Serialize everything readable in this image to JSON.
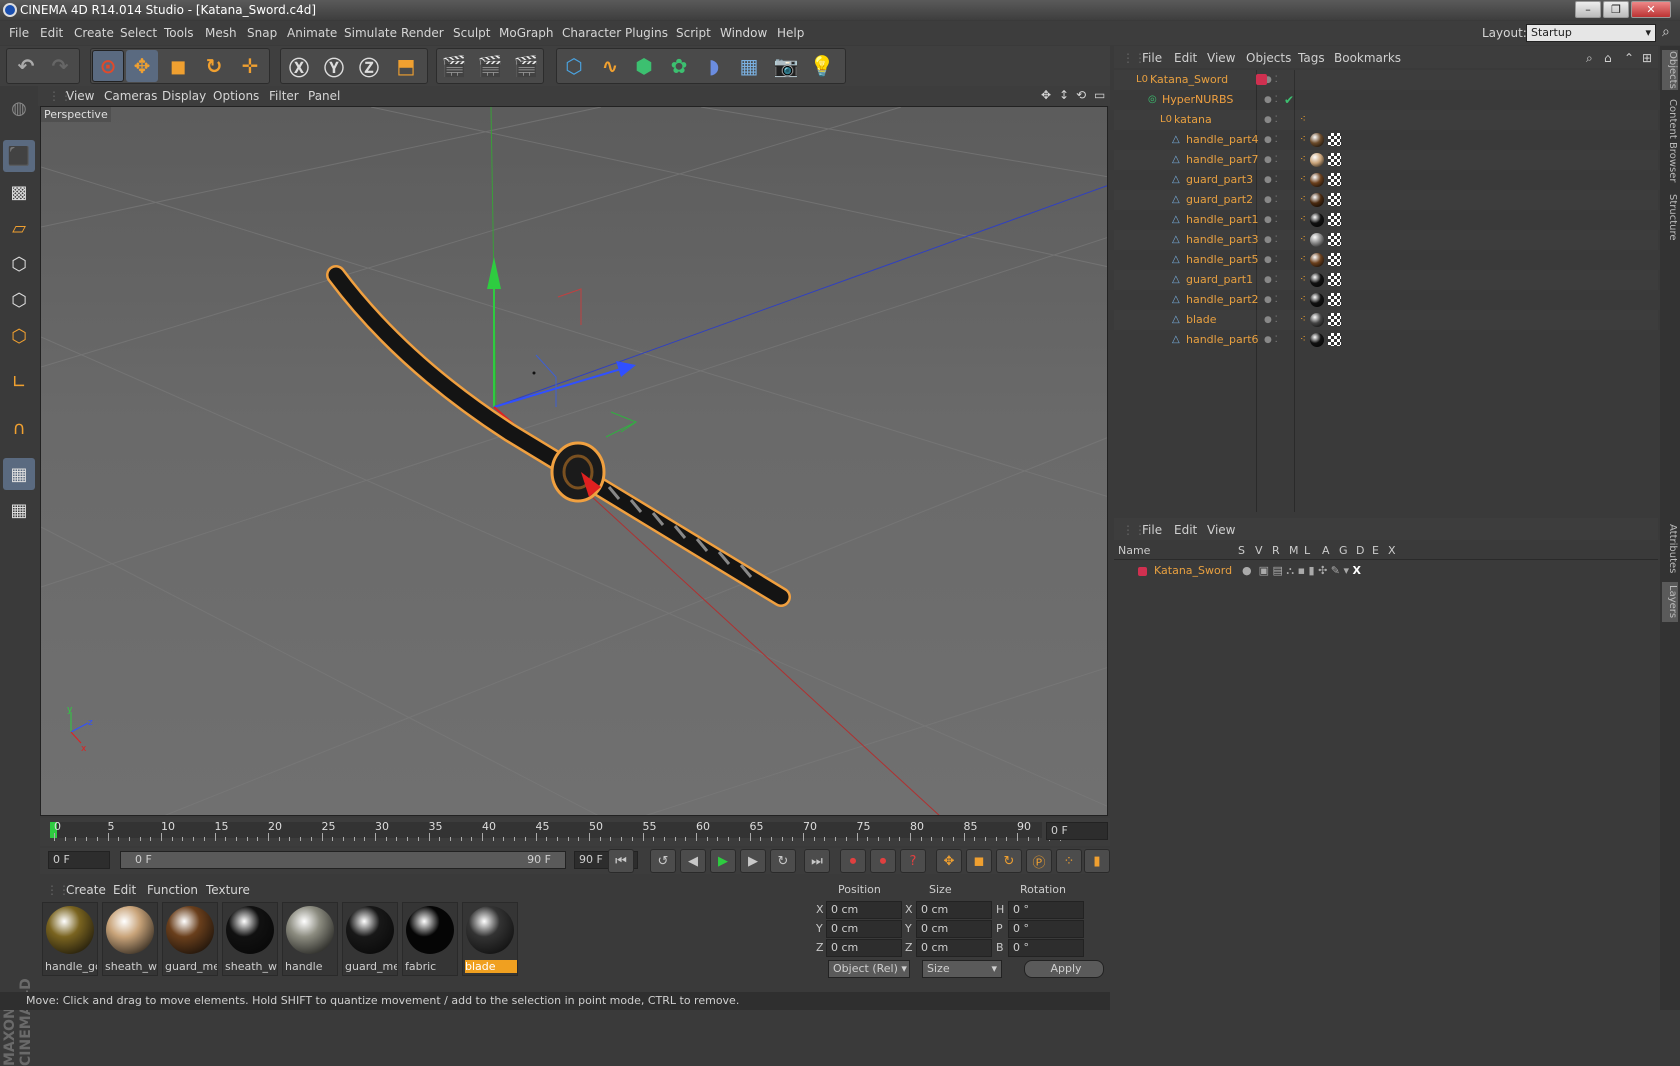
{
  "titlebar": {
    "title": "CINEMA 4D R14.014 Studio - [Katana_Sword.c4d]",
    "min": "–",
    "max": "❐",
    "close": "✕"
  },
  "menu": [
    "File",
    "Edit",
    "Create",
    "Select",
    "Tools",
    "Mesh",
    "Snap",
    "Animate",
    "Simulate",
    "Render",
    "Sculpt",
    "MoGraph",
    "Character",
    "Plugins",
    "Script",
    "Window",
    "Help"
  ],
  "layout": {
    "label": "Layout:",
    "value": "Startup"
  },
  "viewport": {
    "menu": [
      "View",
      "Cameras",
      "Display",
      "Options",
      "Filter",
      "Panel"
    ],
    "label": "Perspective"
  },
  "timeline": {
    "ticks": [
      "0",
      "5",
      "10",
      "15",
      "20",
      "25",
      "30",
      "35",
      "40",
      "45",
      "50",
      "55",
      "60",
      "65",
      "70",
      "75",
      "80",
      "85",
      "90"
    ],
    "end_field": "0 F"
  },
  "transport": {
    "start": "0 F",
    "range_start": "0 F",
    "range_end": "90 F",
    "end": "90 F"
  },
  "materials": {
    "menu": [
      "Create",
      "Edit",
      "Function",
      "Texture"
    ],
    "items": [
      {
        "label": "handle_go",
        "color": "#7a6420"
      },
      {
        "label": "sheath_wo",
        "color": "#c9a47a"
      },
      {
        "label": "guard_met",
        "color": "#6a3f1c"
      },
      {
        "label": "sheath_wo",
        "color": "#111111"
      },
      {
        "label": "handle",
        "color": "#8c8c80"
      },
      {
        "label": "guard_met",
        "color": "#181818"
      },
      {
        "label": "fabric",
        "color": "#050505"
      },
      {
        "label": "blade",
        "color": "#333333"
      }
    ]
  },
  "coords": {
    "headers": [
      "Position",
      "Size",
      "Rotation"
    ],
    "rows": [
      {
        "a": "X",
        "pos": "0 cm",
        "b": "X",
        "size": "0 cm",
        "c": "H",
        "rot": "0 °"
      },
      {
        "a": "Y",
        "pos": "0 cm",
        "b": "Y",
        "size": "0 cm",
        "c": "P",
        "rot": "0 °"
      },
      {
        "a": "Z",
        "pos": "0 cm",
        "b": "Z",
        "size": "0 cm",
        "c": "B",
        "rot": "0 °"
      }
    ],
    "mode": "Object (Rel)",
    "size_mode": "Size",
    "apply": "Apply"
  },
  "status": "Move: Click and drag to move elements. Hold SHIFT to quantize movement / add to the selection in point mode, CTRL to remove.",
  "objects": {
    "menu": [
      "File",
      "Edit",
      "View",
      "Objects",
      "Tags",
      "Bookmarks"
    ],
    "items": [
      "Katana_Sword",
      "HyperNURBS",
      "katana",
      "handle_part4",
      "handle_part7",
      "guard_part3",
      "guard_part2",
      "handle_part1",
      "handle_part3",
      "handle_part5",
      "guard_part1",
      "handle_part2",
      "blade",
      "handle_part6"
    ]
  },
  "layers": {
    "menu": [
      "File",
      "Edit",
      "View"
    ],
    "columns": [
      "Name",
      "S",
      "V",
      "R",
      "M",
      "L",
      "A",
      "G",
      "D",
      "E",
      "X"
    ],
    "row": "Katana_Sword"
  },
  "side_tabs": [
    "Objects",
    "Content Browser",
    "Structure",
    "Attributes",
    "Layers"
  ],
  "brand": "MAXON CINEMA 4D"
}
